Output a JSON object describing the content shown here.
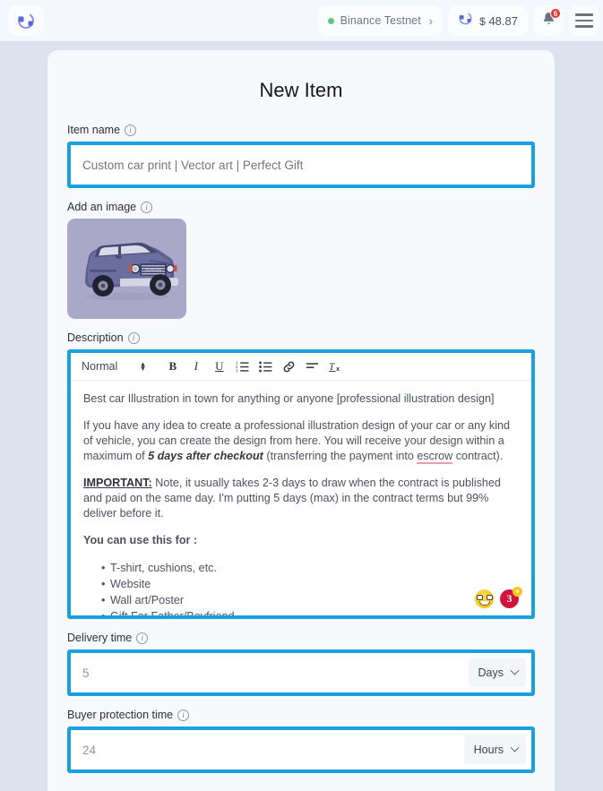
{
  "topbar": {
    "logo_icon": "orbit-ring-logo",
    "network": {
      "label": "Binance Testnet",
      "status_color": "#5cc97a",
      "chevron": "›"
    },
    "balance": {
      "currency": "$",
      "amount": "48.87",
      "icon": "orbit-ring-icon"
    },
    "notifications": {
      "icon": "bell-icon",
      "count": "6",
      "badge_color": "#e8332a"
    },
    "menu": {
      "icon": "hamburger-menu-icon"
    }
  },
  "page": {
    "title": "New Item"
  },
  "fields": {
    "item_name": {
      "label": "Item name",
      "info": "i",
      "placeholder": "Custom car print | Vector art | Perfect Gift",
      "value": ""
    },
    "add_image": {
      "label": "Add an image",
      "info": "i",
      "thumb_alt": "blue suv car illustration"
    },
    "description": {
      "label": "Description",
      "info": "i"
    },
    "delivery_time": {
      "label": "Delivery time",
      "info": "i",
      "value": "5",
      "unit": "Days"
    },
    "buyer_protection_time": {
      "label": "Buyer protection time",
      "info": "i",
      "value": "24",
      "unit": "Hours"
    }
  },
  "editor": {
    "toolbar": {
      "format": "Normal",
      "bold": "B",
      "italic": "I",
      "underline": "U",
      "ordered_list": "ordered-list-icon",
      "bullet_list": "bullet-list-icon",
      "link": "link-icon",
      "align": "align-icon",
      "clear_format": "clear-format-icon"
    },
    "content": {
      "p1": "Best car Illustration in town for anything or anyone [professional illustration design]",
      "p2_a": "If you have any idea to create a professional illustration design of your car or any kind of vehicle, you can create the design from here. You will receive your design within a maximum of ",
      "p2_b": "5 days after checkout",
      "p2_c": " (transferring the payment into ",
      "p2_escrow": "escrow",
      "p2_d": " contract).",
      "p3_important": "IMPORTANT:",
      "p3_rest": " Note, it usually takes 2-3 days to draw when the contract is published and paid on the same day. I'm putting 5 days (max) in the contract terms but 99% deliver before it.",
      "uses_heading": "You can use this for :",
      "uses": [
        "T-shirt, cushions, etc.",
        "Website",
        "Wall art/Poster",
        "Gift For Father/Boyfriend"
      ],
      "reaction_nerd": "nerd-face-emoji",
      "reaction_count": "3",
      "reaction_plus": "+"
    }
  }
}
